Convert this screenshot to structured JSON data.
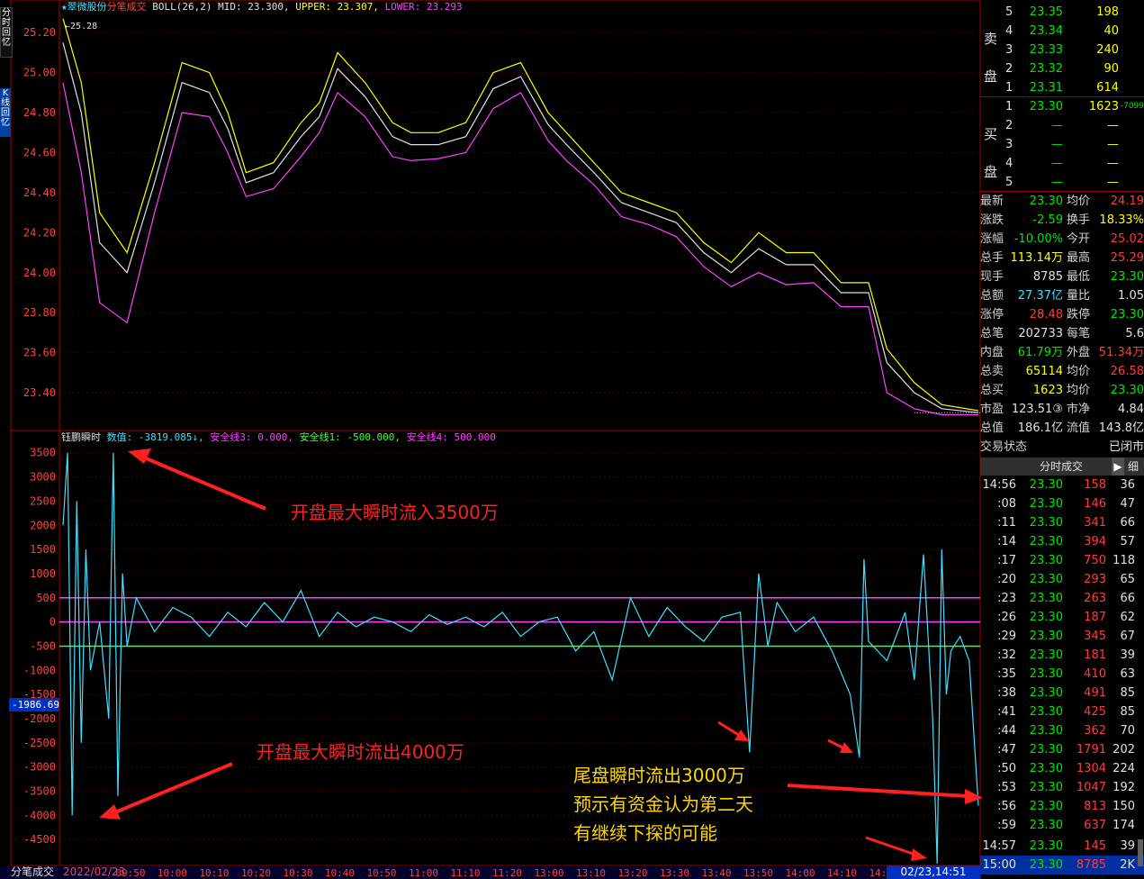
{
  "side_tabs": [
    {
      "label": "分时回忆"
    },
    {
      "label": "K线回忆"
    }
  ],
  "price_legend": {
    "name": "翠微股份",
    "mode": "分笔成交",
    "boll": "BOLL(26,2)",
    "mid": "MID: 23.300,",
    "upper": "UPPER: 23.307,",
    "lower": "LOWER: 23.293"
  },
  "indicator_legend": {
    "name": "钰鹏瞬时",
    "value": "数值: -3819.085↓,",
    "safe3": "安全线3: 0.000,",
    "safe1": "安全线1: -500.000,",
    "safe4": "安全线4: 500.000"
  },
  "cursor_value": "-1986.69",
  "bottom_labels": {
    "left": "分笔成交",
    "date": "2022/02/23",
    "right_date": "02/23,14:51"
  },
  "annotations": [
    {
      "text": "开盘最大瞬时流入3500万"
    },
    {
      "text": "开盘最大瞬时流出4000万"
    },
    {
      "text": "尾盘瞬时流出3000万"
    },
    {
      "text": "预示有资金认为第二天"
    },
    {
      "text": "有继续下探的可能"
    }
  ],
  "sell_side_label": [
    "卖",
    "盘"
  ],
  "buy_side_label": [
    "买",
    "盘"
  ],
  "order_book": {
    "sells": [
      {
        "level": "5",
        "price": "23.35",
        "vol": "198"
      },
      {
        "level": "4",
        "price": "23.34",
        "vol": "40"
      },
      {
        "level": "3",
        "price": "23.33",
        "vol": "240"
      },
      {
        "level": "2",
        "price": "23.32",
        "vol": "90"
      },
      {
        "level": "1",
        "price": "23.31",
        "vol": "614"
      }
    ],
    "buys": [
      {
        "level": "1",
        "price": "23.30",
        "vol": "1623",
        "extra": "-7099"
      },
      {
        "level": "2",
        "price": "—",
        "vol": "—",
        "extra": ""
      },
      {
        "level": "3",
        "price": "—",
        "vol": "—",
        "extra": ""
      },
      {
        "level": "4",
        "price": "—",
        "vol": "—",
        "extra": ""
      },
      {
        "level": "5",
        "price": "—",
        "vol": "—",
        "extra": ""
      }
    ]
  },
  "quote_stats": [
    {
      "l1": "最新",
      "v1": "23.30",
      "c1": "grn",
      "l2": "均价",
      "v2": "24.19",
      "c2": "red"
    },
    {
      "l1": "涨跌",
      "v1": "-2.59",
      "c1": "grn",
      "l2": "换手",
      "v2": "18.33%",
      "c2": "yel"
    },
    {
      "l1": "涨幅",
      "v1": "-10.00%",
      "c1": "grn",
      "l2": "今开",
      "v2": "25.02",
      "c2": "red"
    },
    {
      "l1": "总手",
      "v1": "113.14万",
      "c1": "yel",
      "l2": "最高",
      "v2": "25.29",
      "c2": "red"
    },
    {
      "l1": "现手",
      "v1": "8785",
      "c1": "wht",
      "l2": "最低",
      "v2": "23.30",
      "c2": "grn"
    },
    {
      "l1": "总额",
      "v1": "27.37亿",
      "c1": "cyan",
      "l2": "量比",
      "v2": "1.05",
      "c2": "wht"
    },
    {
      "l1": "涨停",
      "v1": "28.48",
      "c1": "red",
      "l2": "跌停",
      "v2": "23.30",
      "c2": "grn"
    },
    {
      "l1": "总笔",
      "v1": "202733",
      "c1": "wht",
      "l2": "每笔",
      "v2": "5.6",
      "c2": "wht"
    },
    {
      "l1": "内盘",
      "v1": "61.79万",
      "c1": "grn",
      "l2": "外盘",
      "v2": "51.34万",
      "c2": "red"
    },
    {
      "l1": "总卖",
      "v1": "65114",
      "c1": "yel",
      "l2": "均价",
      "v2": "26.58",
      "c2": "red"
    },
    {
      "l1": "总买",
      "v1": "1623",
      "c1": "yel",
      "l2": "均价",
      "v2": "23.30",
      "c2": "grn"
    },
    {
      "l1": "市盈",
      "v1": "123.51③",
      "c1": "wht",
      "l2": "市净",
      "v2": "4.84",
      "c2": "wht"
    },
    {
      "l1": "总值",
      "v1": "186.1亿",
      "c1": "wht",
      "l2": "流值",
      "v2": "143.8亿",
      "c2": "wht"
    }
  ],
  "trade_state": {
    "label": "交易状态",
    "value": "已闭市"
  },
  "ticks_header": {
    "title": "分时成交",
    "play": "▶",
    "detail": "细"
  },
  "ticks": [
    {
      "t": "14:56",
      "p": "23.30",
      "v": "158",
      "n": "36"
    },
    {
      "t": ":08",
      "p": "23.30",
      "v": "146",
      "n": "47"
    },
    {
      "t": ":11",
      "p": "23.30",
      "v": "341",
      "n": "66"
    },
    {
      "t": ":14",
      "p": "23.30",
      "v": "394",
      "n": "57"
    },
    {
      "t": ":17",
      "p": "23.30",
      "v": "750",
      "n": "118"
    },
    {
      "t": ":20",
      "p": "23.30",
      "v": "293",
      "n": "65"
    },
    {
      "t": ":23",
      "p": "23.30",
      "v": "263",
      "n": "66"
    },
    {
      "t": ":26",
      "p": "23.30",
      "v": "187",
      "n": "62"
    },
    {
      "t": ":29",
      "p": "23.30",
      "v": "345",
      "n": "67"
    },
    {
      "t": ":32",
      "p": "23.30",
      "v": "181",
      "n": "39"
    },
    {
      "t": ":35",
      "p": "23.30",
      "v": "410",
      "n": "63"
    },
    {
      "t": ":38",
      "p": "23.30",
      "v": "491",
      "n": "85"
    },
    {
      "t": ":41",
      "p": "23.30",
      "v": "425",
      "n": "85"
    },
    {
      "t": ":44",
      "p": "23.30",
      "v": "362",
      "n": "70"
    },
    {
      "t": ":47",
      "p": "23.30",
      "v": "1791",
      "n": "202"
    },
    {
      "t": ":50",
      "p": "23.30",
      "v": "1304",
      "n": "224"
    },
    {
      "t": ":53",
      "p": "23.30",
      "v": "1047",
      "n": "192"
    },
    {
      "t": ":56",
      "p": "23.30",
      "v": "813",
      "n": "150"
    },
    {
      "t": ":59",
      "p": "23.30",
      "v": "637",
      "n": "174"
    },
    {
      "t": "14:57",
      "p": "23.30",
      "v": "145",
      "n": "39"
    },
    {
      "t": "15:00",
      "p": "23.30",
      "v": "8785",
      "n": "2K"
    }
  ],
  "chart_data": [
    {
      "type": "line",
      "ylim": [
        23.22,
        25.3
      ],
      "yticks": [
        "25.20",
        "25.00",
        "24.80",
        "24.60",
        "24.40",
        "24.20",
        "24.00",
        "23.80",
        "23.60",
        "23.40"
      ],
      "high_marker": "25.28",
      "series": [
        {
          "name": "UPPER",
          "x": [
            0.0,
            0.02,
            0.04,
            0.07,
            0.1,
            0.13,
            0.16,
            0.18,
            0.2,
            0.23,
            0.26,
            0.28,
            0.3,
            0.33,
            0.36,
            0.38,
            0.41,
            0.44,
            0.47,
            0.5,
            0.53,
            0.55,
            0.58,
            0.61,
            0.64,
            0.67,
            0.7,
            0.73,
            0.76,
            0.79,
            0.82,
            0.85,
            0.88,
            0.9,
            0.93,
            0.96,
            1.0
          ],
          "values": [
            25.27,
            24.95,
            24.3,
            24.1,
            24.55,
            25.05,
            25.0,
            24.8,
            24.5,
            24.55,
            24.75,
            24.85,
            25.1,
            24.95,
            24.75,
            24.7,
            24.7,
            24.75,
            25.0,
            25.05,
            24.8,
            24.7,
            24.55,
            24.4,
            24.35,
            24.3,
            24.15,
            24.05,
            24.2,
            24.1,
            24.1,
            23.95,
            23.95,
            23.62,
            23.45,
            23.34,
            23.31
          ]
        },
        {
          "name": "MID",
          "x": [
            0.0,
            0.02,
            0.04,
            0.07,
            0.1,
            0.13,
            0.16,
            0.18,
            0.2,
            0.23,
            0.26,
            0.28,
            0.3,
            0.33,
            0.36,
            0.38,
            0.41,
            0.44,
            0.47,
            0.5,
            0.53,
            0.55,
            0.58,
            0.61,
            0.64,
            0.67,
            0.7,
            0.73,
            0.76,
            0.79,
            0.82,
            0.85,
            0.88,
            0.9,
            0.93,
            0.96,
            1.0
          ],
          "values": [
            25.15,
            24.8,
            24.15,
            24.0,
            24.45,
            24.95,
            24.9,
            24.72,
            24.45,
            24.5,
            24.68,
            24.78,
            25.02,
            24.88,
            24.68,
            24.64,
            24.64,
            24.68,
            24.92,
            24.98,
            24.74,
            24.64,
            24.5,
            24.35,
            24.3,
            24.25,
            24.1,
            24.0,
            24.12,
            24.04,
            24.04,
            23.9,
            23.9,
            23.55,
            23.4,
            23.32,
            23.3
          ]
        },
        {
          "name": "LOWER",
          "x": [
            0.0,
            0.02,
            0.04,
            0.07,
            0.1,
            0.13,
            0.16,
            0.18,
            0.2,
            0.23,
            0.26,
            0.28,
            0.3,
            0.33,
            0.36,
            0.38,
            0.41,
            0.44,
            0.47,
            0.5,
            0.53,
            0.55,
            0.58,
            0.61,
            0.64,
            0.67,
            0.7,
            0.73,
            0.76,
            0.79,
            0.82,
            0.85,
            0.88,
            0.9,
            0.93,
            0.96,
            1.0
          ],
          "values": [
            24.95,
            24.5,
            23.85,
            23.75,
            24.3,
            24.8,
            24.78,
            24.6,
            24.38,
            24.42,
            24.58,
            24.7,
            24.9,
            24.78,
            24.58,
            24.56,
            24.57,
            24.6,
            24.82,
            24.9,
            24.66,
            24.56,
            24.44,
            24.28,
            24.24,
            24.18,
            24.03,
            23.93,
            24.0,
            23.94,
            23.95,
            23.83,
            23.83,
            23.4,
            23.32,
            23.29,
            23.29
          ]
        }
      ]
    },
    {
      "type": "line",
      "ylim": [
        -5000,
        3700
      ],
      "yticks": [
        "3500",
        "3000",
        "2500",
        "2000",
        "1500",
        "1000",
        "500",
        "0",
        "-500",
        "-1000",
        "-1500",
        "-2000",
        "-2500",
        "-3000",
        "-3500",
        "-4000",
        "-4500"
      ],
      "safety_lines": [
        {
          "name": "安全线4",
          "value": 500,
          "color": "#ff40ff"
        },
        {
          "name": "安全线3",
          "value": 0,
          "color": "#ff40ff"
        },
        {
          "name": "安全线1",
          "value": -500,
          "color": "#40ff40"
        }
      ],
      "xticks": [
        "09:50",
        "10:00",
        "10:10",
        "10:20",
        "10:30",
        "10:40",
        "10:50",
        "11:00",
        "11:10",
        "11:20",
        "13:00",
        "13:10",
        "13:20",
        "13:30",
        "13:40",
        "13:50",
        "14:00",
        "14:10",
        "14:20"
      ],
      "series": [
        {
          "name": "钰鹏瞬时",
          "x": [
            0.0,
            0.005,
            0.01,
            0.015,
            0.02,
            0.025,
            0.03,
            0.04,
            0.05,
            0.055,
            0.06,
            0.065,
            0.07,
            0.08,
            0.1,
            0.12,
            0.14,
            0.16,
            0.18,
            0.2,
            0.22,
            0.24,
            0.26,
            0.28,
            0.3,
            0.32,
            0.34,
            0.36,
            0.38,
            0.4,
            0.42,
            0.44,
            0.46,
            0.48,
            0.5,
            0.52,
            0.54,
            0.56,
            0.58,
            0.6,
            0.62,
            0.64,
            0.66,
            0.68,
            0.7,
            0.72,
            0.74,
            0.75,
            0.76,
            0.77,
            0.78,
            0.8,
            0.82,
            0.84,
            0.86,
            0.87,
            0.875,
            0.88,
            0.9,
            0.92,
            0.93,
            0.94,
            0.95,
            0.955,
            0.96,
            0.965,
            0.97,
            0.98,
            0.99,
            1.0
          ],
          "values": [
            2000,
            3500,
            -4000,
            2500,
            -2500,
            1500,
            -1000,
            0,
            -2000,
            3500,
            -3600,
            1000,
            -500,
            500,
            -200,
            300,
            100,
            -300,
            200,
            -100,
            400,
            0,
            650,
            -300,
            200,
            -100,
            100,
            0,
            -200,
            150,
            -50,
            100,
            -100,
            200,
            -300,
            0,
            100,
            -600,
            -200,
            -1200,
            500,
            -300,
            300,
            -100,
            -400,
            100,
            200,
            -2700,
            1000,
            -500,
            400,
            -200,
            100,
            -600,
            -1500,
            -2800,
            1300,
            -400,
            -800,
            200,
            -1200,
            1400,
            -2000,
            -5000,
            1500,
            -1500,
            -600,
            -300,
            -800,
            -3800
          ]
        }
      ]
    }
  ]
}
